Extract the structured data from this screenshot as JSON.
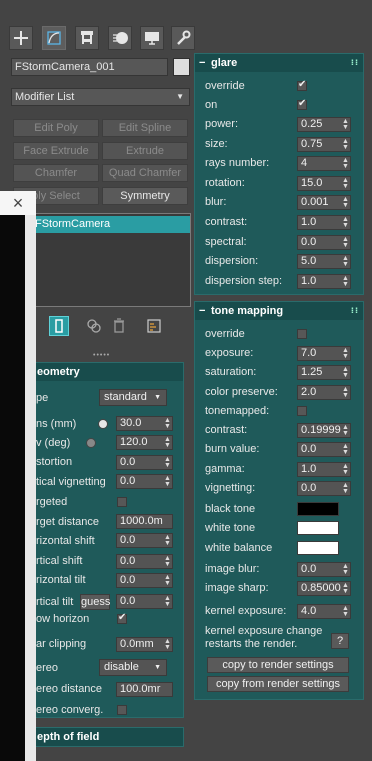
{
  "toolbar": {
    "tabs": [
      {
        "name": "create-tab",
        "icon": "plus-icon"
      },
      {
        "name": "modify-tab",
        "icon": "modify-curve-icon"
      },
      {
        "name": "hierarchy-tab",
        "icon": "hierarchy-icon"
      },
      {
        "name": "motion-tab",
        "icon": "motion-icon"
      },
      {
        "name": "display-tab",
        "icon": "monitor-icon"
      },
      {
        "name": "utilities-tab",
        "icon": "wrench-icon"
      }
    ]
  },
  "modify": {
    "object_name": "FStormCamera_001",
    "swatch_color": "#dedede",
    "modifier_list": "Modifier List",
    "buttons": [
      "Edit Poly",
      "Edit Spline",
      "Face Extrude",
      "Extrude",
      "Chamfer",
      "Quad Chamfer",
      "oly Select",
      "Symmetry"
    ],
    "stack_item": "FStormCamera"
  },
  "geometry": {
    "title": "eometry",
    "type_label": "pe",
    "type_value": "standard",
    "rows": [
      {
        "label": "ns (mm)",
        "value": "30.0"
      },
      {
        "label": "v (deg)",
        "value": "120.0"
      },
      {
        "label": "stortion",
        "value": "0.0"
      },
      {
        "label": "tical vignetting",
        "value": "0.0"
      },
      {
        "label": "rgeted",
        "value": ""
      },
      {
        "label": "rget distance",
        "value": "1000.0m"
      },
      {
        "label": "rizontal shift",
        "value": "0.0"
      },
      {
        "label": "rtical shift",
        "value": "0.0"
      },
      {
        "label": "rizontal tilt",
        "value": "0.0"
      },
      {
        "label": "rtical tilt",
        "value": "0.0"
      },
      {
        "label": "ow horizon",
        "value": ""
      },
      {
        "label": "ar clipping",
        "value": "0.0mm"
      },
      {
        "label": "ereo",
        "value": "disable"
      },
      {
        "label": "ereo distance",
        "value": "100.0mr"
      },
      {
        "label": "ereo converg.",
        "value": ""
      }
    ],
    "guess_label": "guess",
    "dof_title": "epth of field"
  },
  "glare": {
    "title": "glare",
    "override_label": "override",
    "on_label": "on",
    "rows": [
      {
        "label": "power:",
        "value": "0.25"
      },
      {
        "label": "size:",
        "value": "0.75"
      },
      {
        "label": "rays number:",
        "value": "4"
      },
      {
        "label": "rotation:",
        "value": "15.0"
      },
      {
        "label": "blur:",
        "value": "0.001"
      },
      {
        "label": "contrast:",
        "value": "1.0"
      },
      {
        "label": "spectral:",
        "value": "0.0"
      },
      {
        "label": "dispersion:",
        "value": "5.0"
      },
      {
        "label": "dispersion step:",
        "value": "1.0"
      }
    ]
  },
  "tone": {
    "title": "tone mapping",
    "override_label": "override",
    "rows": [
      {
        "label": "exposure:",
        "value": "7.0"
      },
      {
        "label": "saturation:",
        "value": "1.25"
      },
      {
        "label": "color preserve:",
        "value": "2.0"
      }
    ],
    "tonemapped_label": "tonemapped:",
    "rows2": [
      {
        "label": "contrast:",
        "value": "0.19999"
      },
      {
        "label": "burn value:",
        "value": "0.0"
      },
      {
        "label": "gamma:",
        "value": "1.0"
      },
      {
        "label": "vignetting:",
        "value": "0.0"
      }
    ],
    "colors": [
      {
        "label": "black tone",
        "color": "#000000"
      },
      {
        "label": "white tone",
        "color": "#ffffff"
      },
      {
        "label": "white balance",
        "color": "#ffffff"
      }
    ],
    "rows3": [
      {
        "label": "image blur:",
        "value": "0.0"
      },
      {
        "label": "image sharp:",
        "value": "0.85000"
      }
    ],
    "kernel_label": "kernel exposure:",
    "kernel_value": "4.0",
    "kernel_note_1": "kernel exposure change",
    "kernel_note_2": "restarts the render.",
    "help_label": "?",
    "copy_to": "copy to render settings",
    "copy_from": "copy from render settings"
  },
  "close_label": "×"
}
